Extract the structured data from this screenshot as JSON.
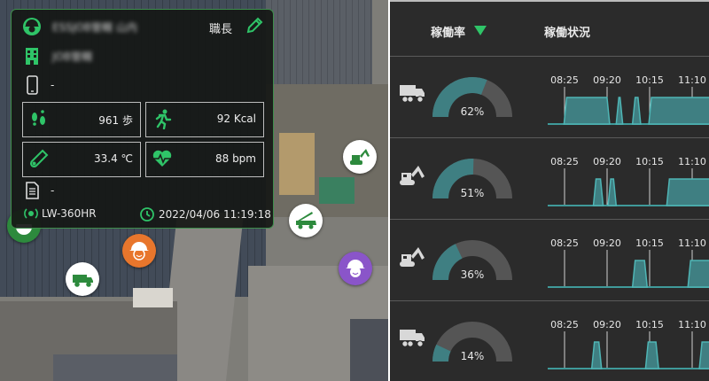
{
  "worker": {
    "name_blurred": "ESSJOB管轄 山内",
    "role": "職長",
    "site_blurred": "JOB管轄",
    "phone": "-",
    "steps": "961 歩",
    "calories": "92 Kcal",
    "temperature": "33.4 ℃",
    "heart_rate": "88 bpm",
    "note": "-",
    "device": "LW-360HR",
    "timestamp": "2022/04/06 11:19:18"
  },
  "panel": {
    "header_rate": "稼働率",
    "header_status": "稼働状況",
    "accent": "#2fc468",
    "gauge_fill": "#3f7f82",
    "gauge_track": "#555555"
  },
  "time_ticks": [
    "08:25",
    "09:20",
    "10:15",
    "11:10"
  ],
  "machines": [
    {
      "icon": "dump-truck-icon",
      "rate": 62,
      "rate_label": "62%"
    },
    {
      "icon": "excavator-icon",
      "rate": 51,
      "rate_label": "51%"
    },
    {
      "icon": "excavator-icon",
      "rate": 36,
      "rate_label": "36%"
    },
    {
      "icon": "dump-truck-icon",
      "rate": 14,
      "rate_label": "14%"
    }
  ],
  "map_pins": [
    {
      "name": "pin-worker-green",
      "color": "#2d8a3d",
      "icon": "worker-icon"
    },
    {
      "name": "pin-worker-orange",
      "color": "#e8762c",
      "icon": "worker-icon"
    },
    {
      "name": "pin-worker-purple",
      "color": "#8a55c9",
      "icon": "worker-icon"
    },
    {
      "name": "pin-dump-truck",
      "color": "#ffffff",
      "icon": "dump-truck-icon"
    },
    {
      "name": "pin-excavator",
      "color": "#ffffff",
      "icon": "excavator-icon"
    },
    {
      "name": "pin-crane-truck",
      "color": "#ffffff",
      "icon": "crane-truck-icon"
    }
  ]
}
